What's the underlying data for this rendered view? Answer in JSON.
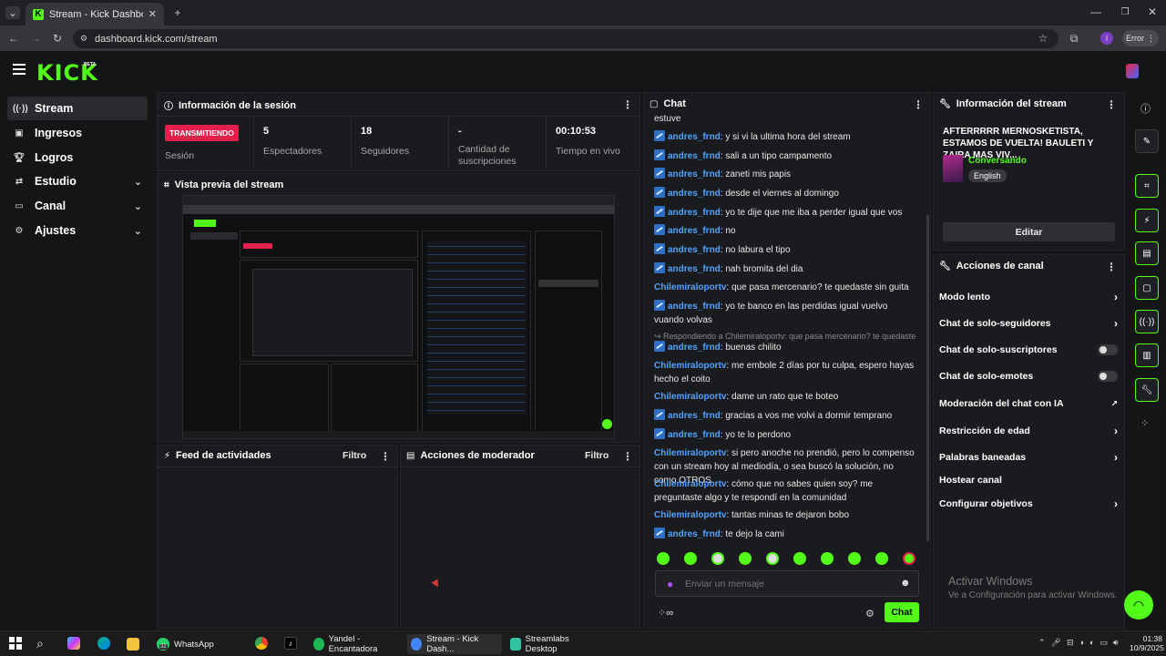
{
  "browser": {
    "tab_title": "Stream - Kick Dashboard",
    "url": "dashboard.kick.com/stream",
    "profile_initial": "I",
    "error_label": "Error"
  },
  "brand": {
    "logo": "KICK",
    "beta": "BETA"
  },
  "sidebar": {
    "items": [
      {
        "label": "Stream",
        "icon": "broadcast-icon"
      },
      {
        "label": "Ingresos",
        "icon": "money-icon"
      },
      {
        "label": "Logros",
        "icon": "trophy-icon"
      },
      {
        "label": "Estudio",
        "icon": "studio-icon"
      },
      {
        "label": "Canal",
        "icon": "channel-icon"
      },
      {
        "label": "Ajustes",
        "icon": "gear-icon"
      }
    ]
  },
  "session": {
    "title": "Información de la sesión",
    "live_badge": "TRANSMITIENDO",
    "session_label": "Sesión",
    "stats": [
      {
        "value": "5",
        "label": "Espectadores"
      },
      {
        "value": "18",
        "label": "Seguidores"
      },
      {
        "value": "-",
        "label": "Cantidad de suscripciones"
      },
      {
        "value": "00:10:53",
        "label": "Tiempo en vivo"
      }
    ]
  },
  "preview": {
    "title": "Vista previa del stream"
  },
  "activity": {
    "title": "Feed de actividades",
    "filter": "Filtro"
  },
  "moderator": {
    "title": "Acciones de moderador",
    "filter": "Filtro"
  },
  "chat": {
    "title": "Chat",
    "first_line": "estuve",
    "messages": [
      {
        "user": "andres_frnd",
        "text": ": y si vi la ultima hora del stream",
        "badge": true
      },
      {
        "user": "andres_frnd",
        "text": ": sali a un tipo campamento",
        "badge": true
      },
      {
        "user": "andres_frnd",
        "text": ": zaneti mis papis",
        "badge": true
      },
      {
        "user": "andres_frnd",
        "text": ": desde el viernes al domingo",
        "badge": true
      },
      {
        "user": "andres_frnd",
        "text": ": yo te dije que me iba a perder igual que vos",
        "badge": true
      },
      {
        "user": "andres_frnd",
        "text": ": no",
        "badge": true
      },
      {
        "user": "andres_frnd",
        "text": ": no labura el tipo",
        "badge": true
      },
      {
        "user": "andres_frnd",
        "text": ": nah bromita del dia",
        "badge": true
      },
      {
        "user": "Chilemiraloportv",
        "text": ": que pasa mercenario? te quedaste sin guita",
        "badge": false
      },
      {
        "user": "andres_frnd",
        "text": ": yo te banco en las perdidas igual vuelvo vuando volvas",
        "badge": true
      },
      {
        "reply": "Respondiendo a Chilemiraloportv: que pasa mercenario? te quedaste ..."
      },
      {
        "user": "andres_frnd",
        "text": ": buenas chilito",
        "badge": true
      },
      {
        "user": "Chilemiraloportv",
        "text": ": me embole 2 días por tu culpa, espero hayas hecho el coito",
        "badge": false
      },
      {
        "user": "Chilemiraloportv",
        "text": ": dame un rato que te boteo",
        "badge": false
      },
      {
        "user": "andres_frnd",
        "text": ": gracias a vos me volvi a dormir temprano",
        "badge": true
      },
      {
        "user": "andres_frnd",
        "text": ": yo te lo perdono",
        "badge": true
      },
      {
        "user": "Chilemiraloportv",
        "text": ": si pero anoche no prendió, pero lo compenso con un stream hoy al mediodía, o sea buscó la solución, no como OTROS",
        "badge": false
      },
      {
        "user": "Chilemiraloportv",
        "text": ": cómo que no sabes quien soy? me preguntaste algo y te respondí en la comunidad",
        "badge": false
      },
      {
        "user": "Chilemiraloportv",
        "text": ": tantas minas te dejaron bobo",
        "badge": false
      },
      {
        "user": "andres_frnd",
        "text": ": te dejo la cami",
        "badge": true
      }
    ],
    "input_placeholder": "Enviar un mensaje",
    "send_label": "Chat"
  },
  "stream_info": {
    "title": "Información del stream",
    "stream_title": "AFTERRRRR MERNOSKETISTA, ESTAMOS DE VUELTA! BAULETI Y ZAIRA MAS VIV...",
    "category": "Conversando",
    "language": "English",
    "edit_label": "Editar"
  },
  "channel_actions": {
    "title": "Acciones de canal",
    "items": [
      {
        "label": "Modo lento",
        "control": "chevron"
      },
      {
        "label": "Chat de solo-seguidores",
        "control": "chevron"
      },
      {
        "label": "Chat de solo-suscriptores",
        "control": "toggle"
      },
      {
        "label": "Chat de solo-emotes",
        "control": "toggle"
      },
      {
        "label": "Moderación del chat con IA",
        "control": "external"
      },
      {
        "label": "Restricción de edad",
        "control": "chevron"
      },
      {
        "label": "Palabras baneadas",
        "control": "chevron"
      },
      {
        "label": "Hostear canal",
        "control": "none"
      },
      {
        "label": "Configurar objetivos",
        "control": "chevron"
      }
    ]
  },
  "watermark": {
    "title": "Activar Windows",
    "subtitle": "Ve a Configuración para activar Windows."
  },
  "taskbar": {
    "apps": [
      {
        "label": "WhatsApp",
        "color": "#25d366"
      },
      {
        "label": "Yandel - Encantadora",
        "color": "#1db954"
      },
      {
        "label": "Stream - Kick Dash...",
        "color": "#4285f4"
      },
      {
        "label": "Streamlabs Desktop",
        "color": "#31c3a2"
      }
    ],
    "whatsapp_count": "32",
    "time": "01:38",
    "date": "10/9/2025"
  },
  "colors": {
    "accent": "#53fc18",
    "live": "#e2204b",
    "username": "#4fa3ff"
  }
}
